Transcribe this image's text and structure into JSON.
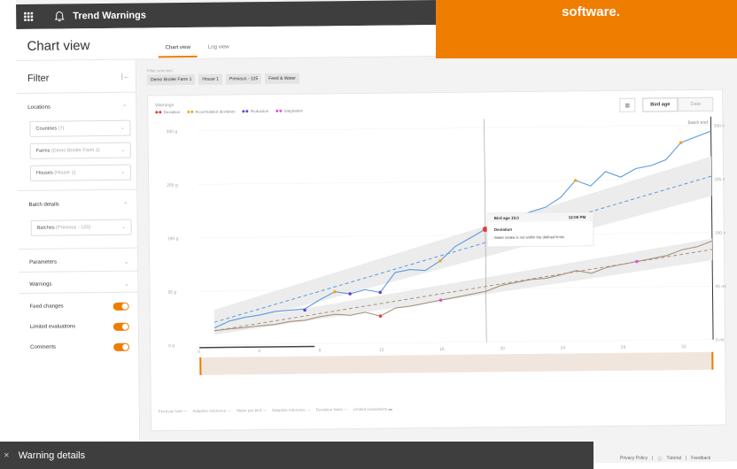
{
  "app": {
    "title": "Trend Warnings",
    "page_title": "Chart view"
  },
  "banner": {
    "text": "software."
  },
  "tabs": [
    {
      "label": "Chart view",
      "active": true
    },
    {
      "label": "Log view",
      "active": false
    }
  ],
  "sidebar": {
    "title": "Filter",
    "sections": {
      "locations": "Locations",
      "batch_details": "Batch details",
      "parameters": "Parameters",
      "warnings": "Warnings"
    },
    "selects": {
      "countries": {
        "label": "Countries",
        "value": "(7)"
      },
      "farms": {
        "label": "Farms",
        "value": "(Demo Broiler Farm 1)"
      },
      "houses": {
        "label": "Houses",
        "value": "(House 1)"
      },
      "batches": {
        "label": "Batches",
        "value": "(Previous - 125)"
      }
    },
    "toggles": [
      {
        "label": "Feed changes",
        "on": true
      },
      {
        "label": "Limited evaluations",
        "on": true
      },
      {
        "label": "Comments",
        "on": true
      }
    ]
  },
  "filter_selection": {
    "label": "Filter selection",
    "chips": [
      "Demo Broiler Farm 1",
      "House 1",
      "Previous - 125",
      "Feed & Water"
    ]
  },
  "warnings_panel": {
    "title": "Warnings",
    "legend": [
      {
        "label": "Deviation",
        "color": "#e53935"
      },
      {
        "label": "Accumulated deviation",
        "color": "#f5a623"
      },
      {
        "label": "Reduction",
        "color": "#6a3fd1"
      },
      {
        "label": "Stagnation",
        "color": "#e84dd6"
      }
    ],
    "x_mode": {
      "options": [
        "Bird age",
        "Date"
      ],
      "selected": "Bird age"
    }
  },
  "tooltip": {
    "header_left": "Bird age 19.0",
    "header_right": "12:00 PM",
    "title": "Deviation",
    "text": "Water intake is not within the defined limits"
  },
  "chart_data": {
    "type": "line",
    "x_ticks": [
      0,
      4,
      8,
      12,
      16,
      20,
      24,
      28,
      32
    ],
    "y_left_ticks": [
      "0 g",
      "95 g",
      "190 g",
      "285 g",
      "380 g"
    ],
    "y_right_ticks": [
      "0 ml",
      "95 ml",
      "190 ml",
      "285 ml",
      "380 ml"
    ],
    "right_axis_label": "Batch end",
    "series": [
      {
        "name": "Water per bird",
        "color": "#5b9be0",
        "x": [
          1,
          2,
          3,
          4,
          5,
          6,
          7,
          8,
          9,
          10,
          11,
          12,
          13,
          14,
          15,
          16,
          17,
          18,
          19,
          20,
          21,
          22,
          23,
          24,
          25,
          26,
          27,
          28,
          29,
          30,
          31,
          32,
          33,
          34
        ],
        "y": [
          30,
          42,
          48,
          52,
          58,
          60,
          62,
          78,
          92,
          88,
          95,
          90,
          125,
          130,
          128,
          145,
          170,
          185,
          200,
          205,
          220,
          230,
          238,
          255,
          285,
          275,
          300,
          290,
          305,
          310,
          320,
          350,
          360,
          370
        ]
      },
      {
        "name": "Adaptive reference",
        "color": "#5b9be0",
        "dashed": true,
        "x": [
          1,
          34
        ],
        "y": [
          40,
          290
        ]
      },
      {
        "name": "Feed per bird",
        "color": "#a8927a",
        "x": [
          1,
          2,
          3,
          4,
          5,
          6,
          7,
          8,
          9,
          10,
          11,
          12,
          13,
          14,
          15,
          16,
          17,
          18,
          19,
          20,
          21,
          22,
          23,
          24,
          25,
          26,
          27,
          28,
          29,
          30,
          31,
          32,
          33,
          34
        ],
        "y": [
          25,
          28,
          30,
          33,
          35,
          40,
          42,
          48,
          52,
          50,
          55,
          48,
          62,
          65,
          70,
          75,
          80,
          85,
          90,
          100,
          105,
          110,
          112,
          118,
          125,
          120,
          130,
          135,
          140,
          145,
          150,
          160,
          165,
          175
        ]
      },
      {
        "name": "Adaptive reference",
        "color": "#a8927a",
        "dashed": true,
        "x": [
          1,
          34
        ],
        "y": [
          25,
          160
        ]
      }
    ],
    "markers": [
      {
        "type": "Reduction",
        "x": 7,
        "y": 60
      },
      {
        "type": "Reduction",
        "x": 10,
        "y": 88
      },
      {
        "type": "Reduction",
        "x": 12,
        "y": 90
      },
      {
        "type": "Accumulated deviation",
        "x": 9,
        "y": 92
      },
      {
        "type": "Accumulated deviation",
        "x": 16,
        "y": 145
      },
      {
        "type": "Accumulated deviation",
        "x": 25,
        "y": 285
      },
      {
        "type": "Accumulated deviation",
        "x": 32,
        "y": 350
      },
      {
        "type": "Deviation",
        "x": 19,
        "y": 200
      },
      {
        "type": "Deviation",
        "x": 12,
        "y": 48
      },
      {
        "type": "Stagnation",
        "x": 16,
        "y": 75
      },
      {
        "type": "Stagnation",
        "x": 29,
        "y": 140
      }
    ],
    "bottom_legend": [
      "Feed per bird",
      "Adaptive reference",
      "Water per bird",
      "Adaptive reference",
      "Deviation limits",
      "Limited evaluations"
    ]
  },
  "details": {
    "title": "Warning details"
  },
  "footer": {
    "privacy": "Privacy Policy",
    "tutorial": "Tutorial",
    "feedback": "Feedback"
  }
}
